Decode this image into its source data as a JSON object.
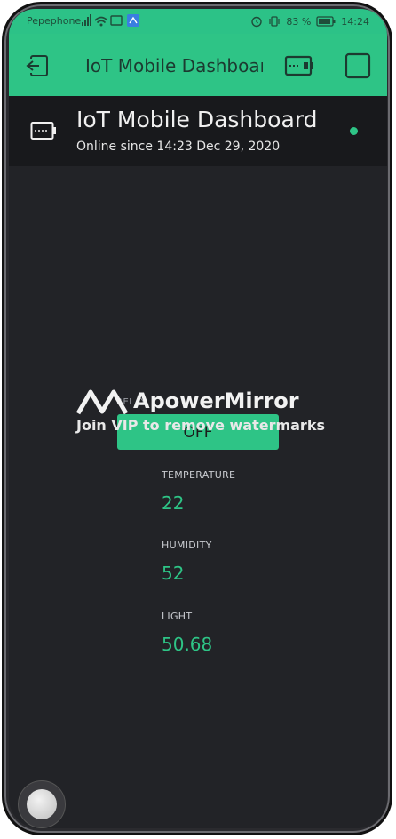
{
  "status_bar": {
    "carrier": "Pepephone",
    "battery": "83 %",
    "time": "14:24"
  },
  "app_bar": {
    "title": "IoT Mobile Dashboard"
  },
  "device": {
    "name": "IoT Mobile Dashboard",
    "online_since": "Online since 14:23 Dec 29, 2020",
    "status_color": "#2ec486"
  },
  "widgets": {
    "relay": {
      "label": "RELAY",
      "button_label": "OFF"
    },
    "temperature": {
      "label": "TEMPERATURE",
      "value": "22"
    },
    "humidity": {
      "label": "HUMIDITY",
      "value": "52"
    },
    "light": {
      "label": "LIGHT",
      "value": "50.68"
    }
  },
  "watermark": {
    "brand": "ApowerMirror",
    "subtitle": "Join VIP to remove watermarks"
  },
  "colors": {
    "accent": "#2ec486",
    "background": "#222327",
    "header": "#18191c"
  }
}
